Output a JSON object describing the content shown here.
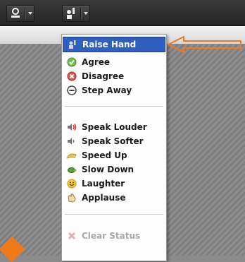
{
  "menu": {
    "items": [
      {
        "label": "Raise Hand",
        "icon": "raise-hand-icon"
      },
      {
        "label": "Agree",
        "icon": "agree-check-icon"
      },
      {
        "label": "Disagree",
        "icon": "disagree-x-icon"
      },
      {
        "label": "Step Away",
        "icon": "step-away-icon"
      },
      {
        "label": "Speak Louder",
        "icon": "speak-louder-icon"
      },
      {
        "label": "Speak Softer",
        "icon": "speak-softer-icon"
      },
      {
        "label": "Speed Up",
        "icon": "speed-up-icon"
      },
      {
        "label": "Slow Down",
        "icon": "slow-down-turtle-icon"
      },
      {
        "label": "Laughter",
        "icon": "laughter-smiley-icon"
      },
      {
        "label": "Applause",
        "icon": "applause-icon"
      },
      {
        "label": "Clear Status",
        "icon": "clear-status-icon"
      }
    ],
    "selected": "Raise Hand"
  },
  "colors": {
    "selection": "#2f5fbf",
    "annotation_arrow": "#f07a1a",
    "toolbar": "#2e2e2e"
  }
}
